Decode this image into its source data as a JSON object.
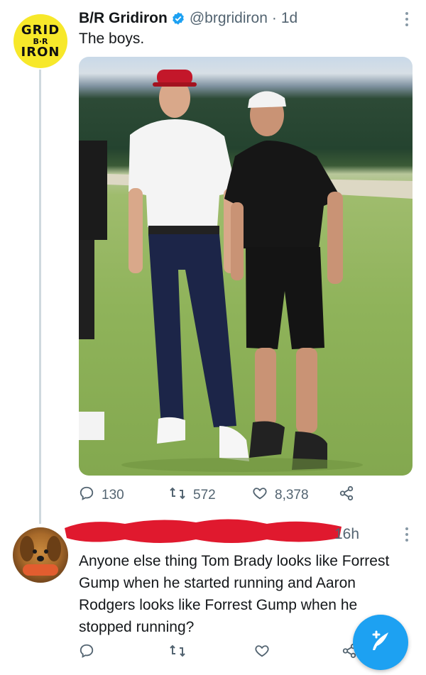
{
  "tweet": {
    "author_name": "B/R Gridiron",
    "author_handle": "@brgridiron",
    "separator": "·",
    "time": "1d",
    "text": "The boys.",
    "avatar_logo": {
      "line1": "GRID",
      "line2": "B·R",
      "line3": "IRON"
    },
    "media_description": "Photo on golf course",
    "stats": {
      "replies": "130",
      "retweets": "572",
      "likes": "8,378"
    }
  },
  "reply": {
    "time": "16h",
    "text": "Anyone else thing Tom Brady looks like Forrest Gump when he started running and Aaron Rodgers looks like Forrest Gump when he stopped running?"
  },
  "icons": [
    "verified-badge-icon",
    "more-icon",
    "reply-icon",
    "retweet-icon",
    "like-icon",
    "share-icon",
    "compose-icon"
  ],
  "colors": {
    "accent": "#1da1f2",
    "redaction": "#e0192e",
    "brand_yellow": "#f7e82a"
  }
}
